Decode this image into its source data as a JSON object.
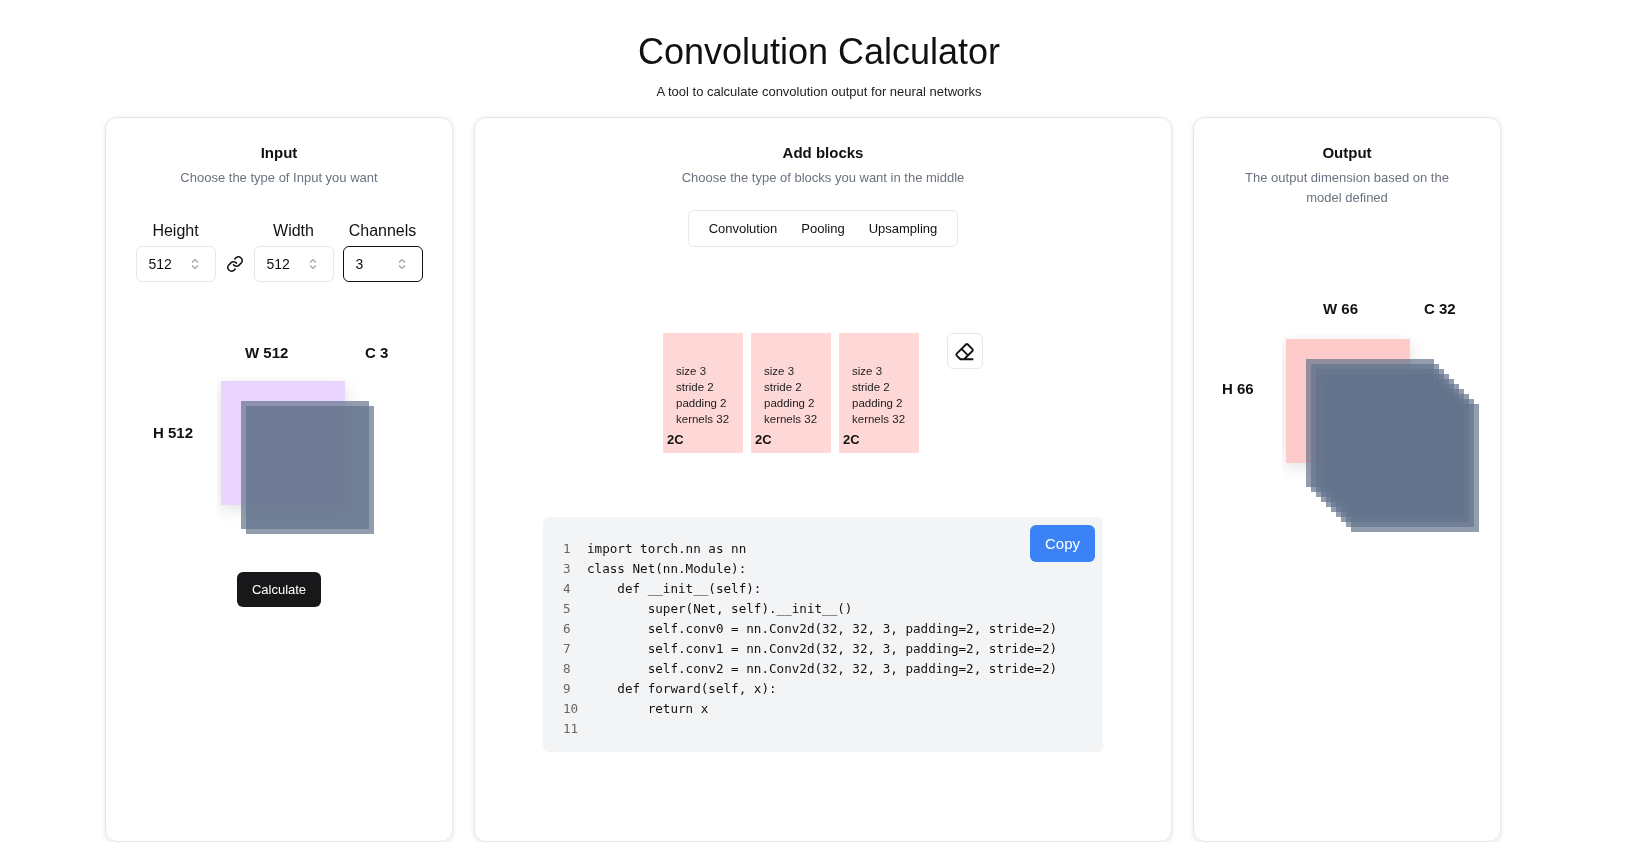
{
  "header": {
    "title": "Convolution Calculator",
    "subtitle": "A tool to calculate convolution output for neural networks"
  },
  "input_panel": {
    "title": "Input",
    "subtitle": "Choose the type of Input you want",
    "fields": [
      {
        "label": "Height",
        "value": "512",
        "focused": false
      },
      {
        "label": "Width",
        "value": "512",
        "focused": false
      },
      {
        "label": "Channels",
        "value": "3",
        "focused": true
      }
    ],
    "linked": true,
    "visual": {
      "width_label": "W 512",
      "channels_label": "C 3",
      "height_label": "H 512",
      "color": "#e9d5ff"
    },
    "button": "Calculate"
  },
  "blocks_panel": {
    "title": "Add blocks",
    "subtitle": "Choose the type of blocks you want in the middle",
    "tabs": [
      "Convolution",
      "Pooling",
      "Upsampling"
    ],
    "blocks": [
      {
        "lines": [
          "size 3",
          "stride 2",
          "padding 2",
          "kernels 32"
        ],
        "tag": "2C"
      },
      {
        "lines": [
          "size 3",
          "stride 2",
          "padding 2",
          "kernels 32"
        ],
        "tag": "2C"
      },
      {
        "lines": [
          "size 3",
          "stride 2",
          "padding 2",
          "kernels 32"
        ],
        "tag": "2C"
      }
    ],
    "code": {
      "copy_button": "Copy",
      "lines": [
        {
          "number": "1",
          "text": "import torch.nn as nn"
        },
        {
          "number": "3",
          "text": "class Net(nn.Module):"
        },
        {
          "number": "4",
          "text": "    def __init__(self):"
        },
        {
          "number": "5",
          "text": "        super(Net, self).__init__()"
        },
        {
          "number": "6",
          "text": "        self.conv0 = nn.Conv2d(32, 32, 3, padding=2, stride=2)"
        },
        {
          "number": "7",
          "text": "        self.conv1 = nn.Conv2d(32, 32, 3, padding=2, stride=2)"
        },
        {
          "number": "8",
          "text": "        self.conv2 = nn.Conv2d(32, 32, 3, padding=2, stride=2)"
        },
        {
          "number": "9",
          "text": "    def forward(self, x):"
        },
        {
          "number": "10",
          "text": "        return x"
        },
        {
          "number": "11"
        }
      ]
    }
  },
  "output_panel": {
    "title": "Output",
    "subtitle": "The output dimension based on the model defined",
    "visual": {
      "width_label": "W 66",
      "channels_label": "C 32",
      "height_label": "H 66",
      "color": "#fecaca"
    }
  }
}
